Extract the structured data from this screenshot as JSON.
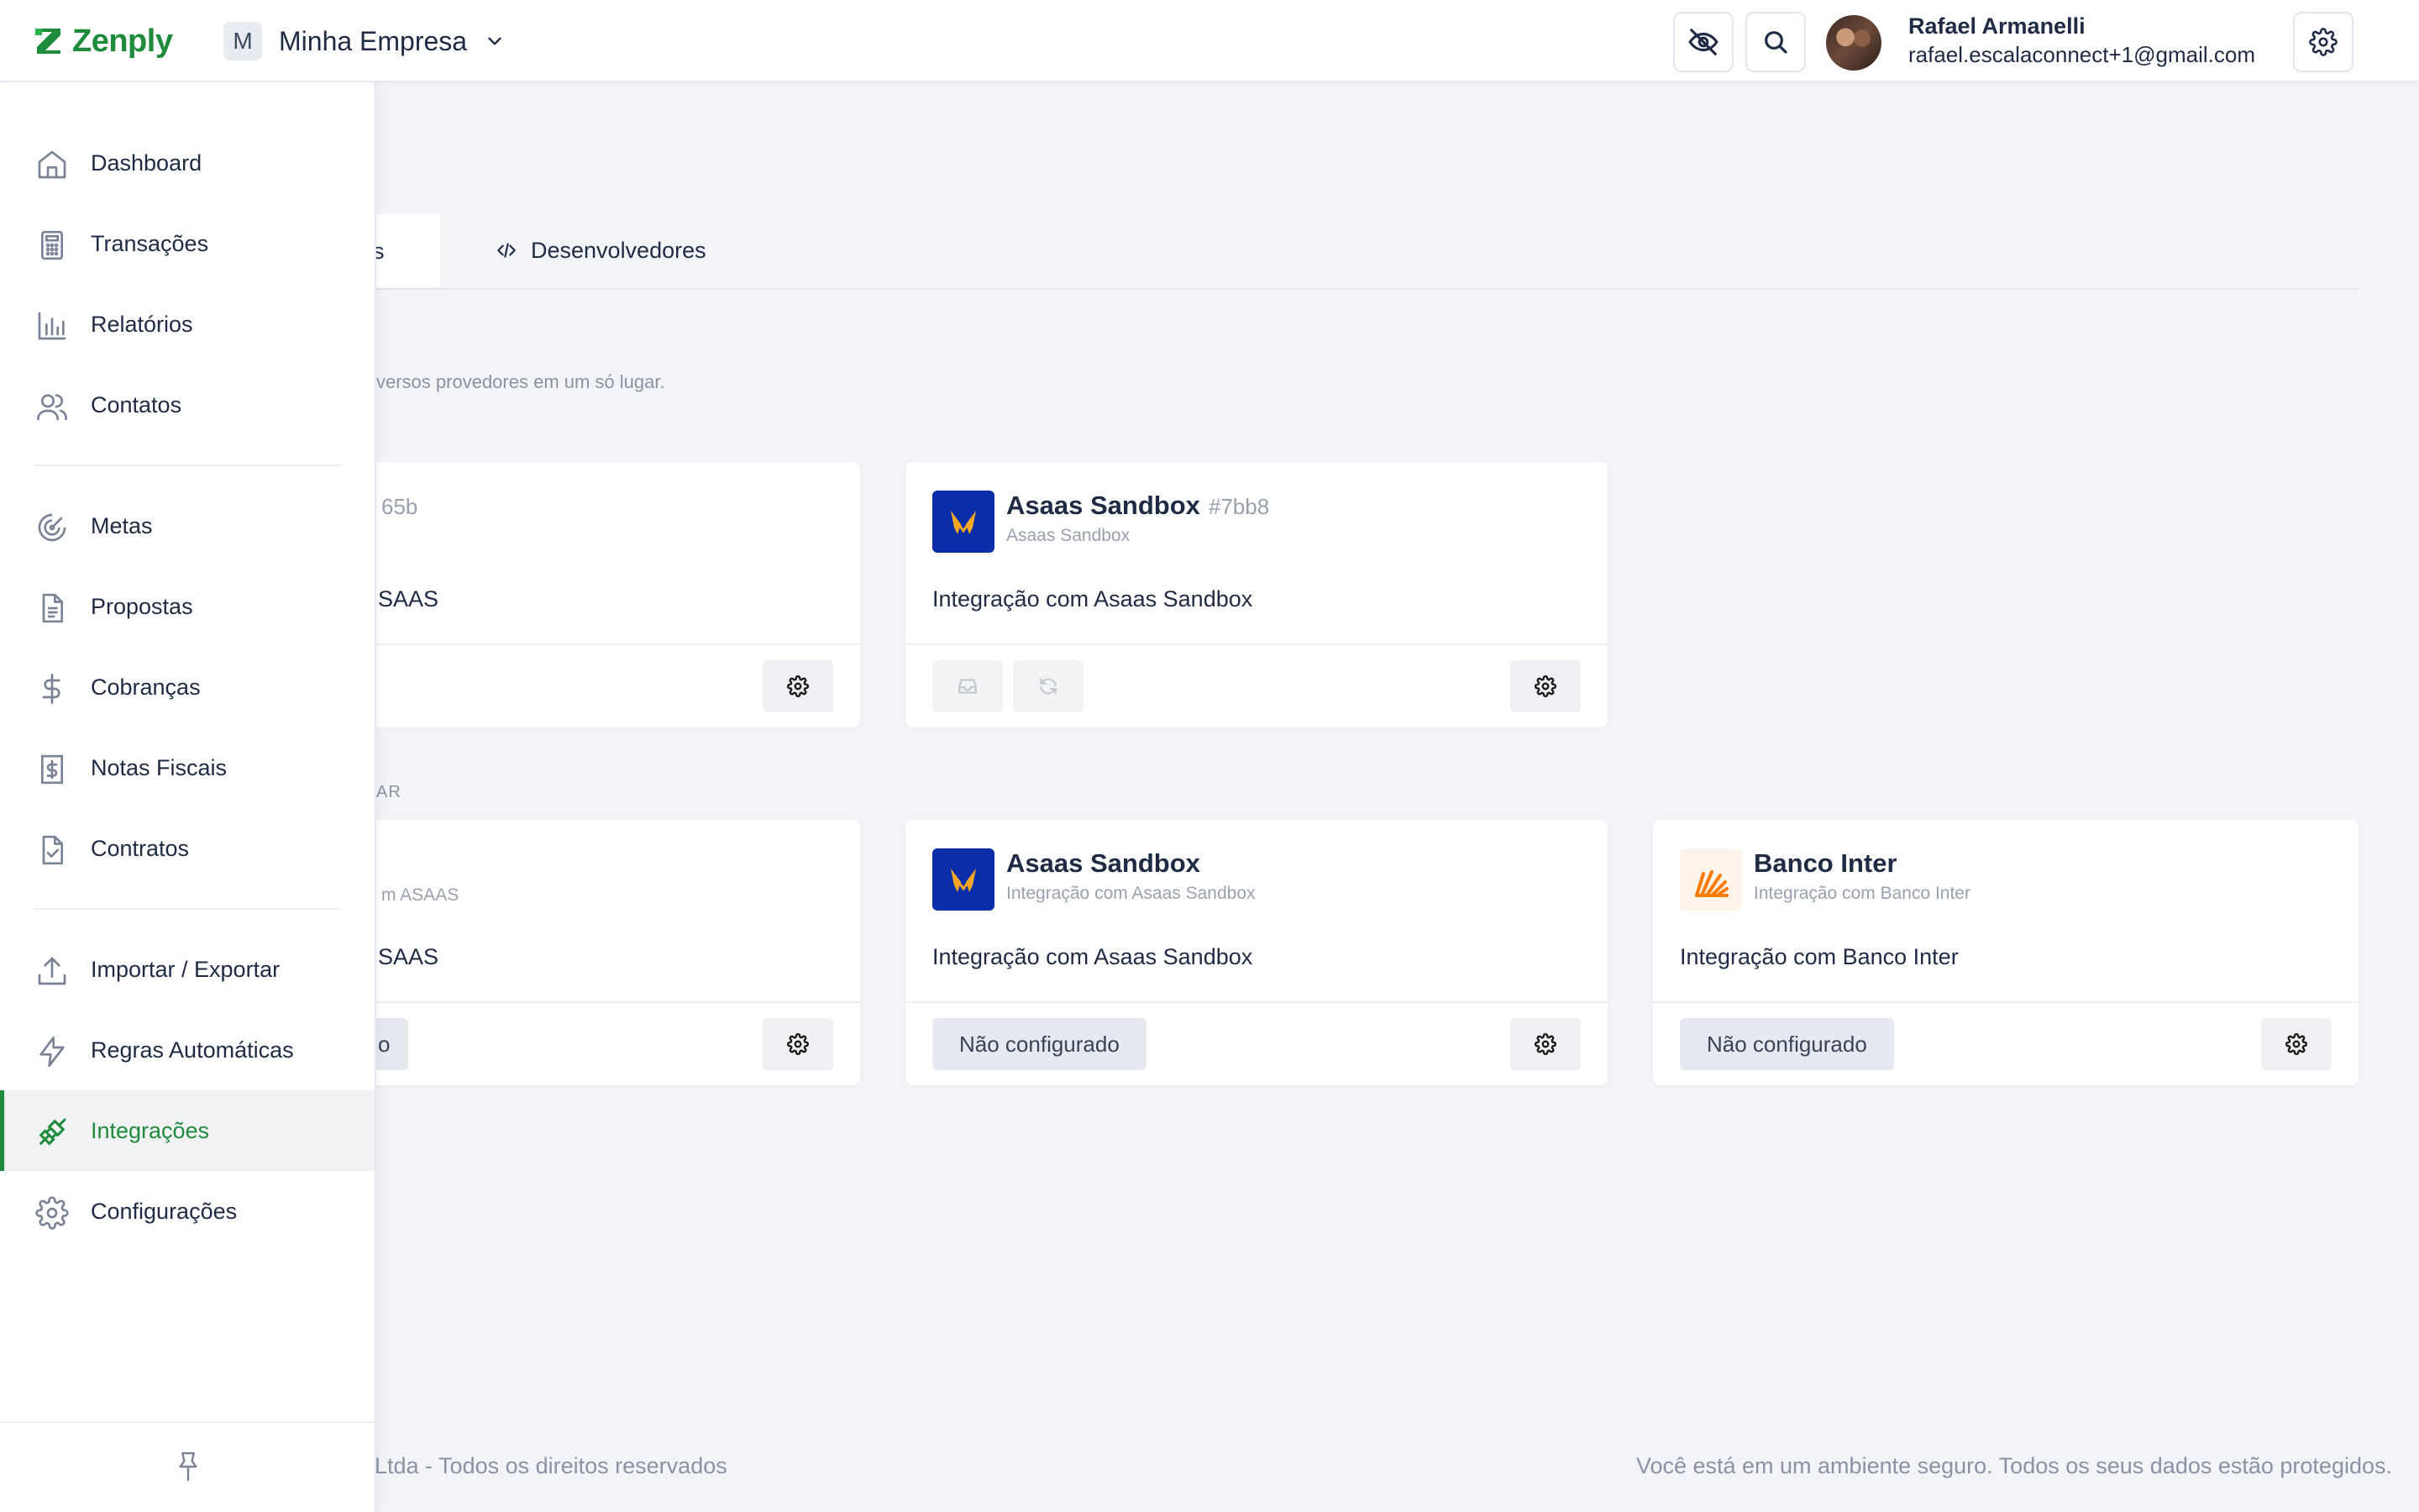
{
  "header": {
    "logo_text": "Zenply",
    "company_initial": "M",
    "company_name": "Minha Empresa",
    "user_name": "Rafael Armanelli",
    "user_email": "rafael.escalaconnect+1@gmail.com"
  },
  "sidebar": {
    "items": [
      {
        "label": "Dashboard",
        "icon": "home-icon"
      },
      {
        "label": "Transações",
        "icon": "calculator-icon"
      },
      {
        "label": "Relatórios",
        "icon": "bar-chart-icon"
      },
      {
        "label": "Contatos",
        "icon": "users-icon"
      },
      {
        "label": "Metas",
        "icon": "target-icon"
      },
      {
        "label": "Propostas",
        "icon": "document-icon"
      },
      {
        "label": "Cobranças",
        "icon": "dollar-icon"
      },
      {
        "label": "Notas Fiscais",
        "icon": "invoice-icon"
      },
      {
        "label": "Contratos",
        "icon": "contract-check-icon"
      },
      {
        "label": "Importar / Exportar",
        "icon": "upload-icon"
      },
      {
        "label": "Regras Automáticas",
        "icon": "lightning-icon"
      },
      {
        "label": "Integrações",
        "icon": "plug-icon"
      },
      {
        "label": "Configurações",
        "icon": "gear-icon"
      }
    ],
    "active": "Integrações"
  },
  "tabs": {
    "active_fragment": "s",
    "developers": "Desenvolvedores"
  },
  "main": {
    "subtitle_fragment": "versos provedores em um só lugar.",
    "section_fragment": "AR"
  },
  "connected": {
    "card1": {
      "hash_fragment": "65b",
      "desc_fragment": "SAAS"
    },
    "card2": {
      "title": "Asaas Sandbox",
      "hash": "#7bb8",
      "sub": "Asaas Sandbox",
      "desc": "Integração com Asaas Sandbox"
    }
  },
  "available": {
    "card1": {
      "sub_fragment": "m ASAAS",
      "desc_fragment": "SAAS",
      "btn_fragment": "o"
    },
    "card2": {
      "title": "Asaas Sandbox",
      "sub": "Integração com Asaas Sandbox",
      "desc": "Integração com Asaas Sandbox",
      "status": "Não configurado"
    },
    "card3": {
      "title": "Banco Inter",
      "sub": "Integração com Banco Inter",
      "desc": "Integração com Banco Inter",
      "status": "Não configurado"
    }
  },
  "footer": {
    "left_fragment": "Ltda - Todos os direitos reservados",
    "right": "Você está em um ambiente seguro. Todos os seus dados estão protegidos."
  },
  "colors": {
    "brand": "#1f8c3b",
    "asaas_blue": "#0a2ea8",
    "asaas_orange": "#f5a623",
    "inter_orange": "#ff7a00"
  }
}
